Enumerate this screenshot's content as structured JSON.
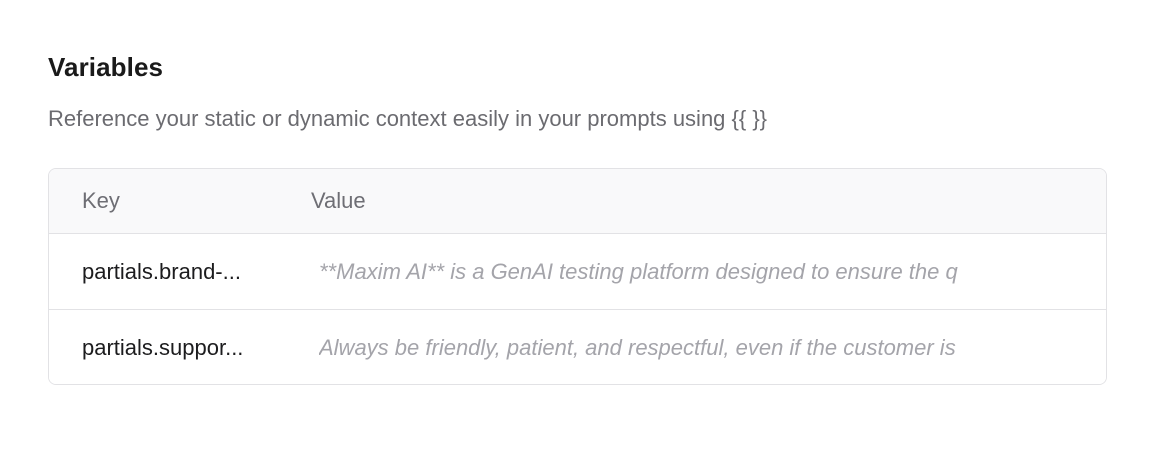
{
  "variables": {
    "title": "Variables",
    "description": "Reference your static or dynamic context easily in your prompts using {{ }}",
    "columns": {
      "key": "Key",
      "value": "Value"
    },
    "rows": [
      {
        "key": "partials.brand-...",
        "value": "**Maxim AI** is a GenAI testing platform designed to ensure the q"
      },
      {
        "key": "partials.suppor...",
        "value": "Always be friendly, patient, and respectful, even if the customer is"
      }
    ]
  }
}
